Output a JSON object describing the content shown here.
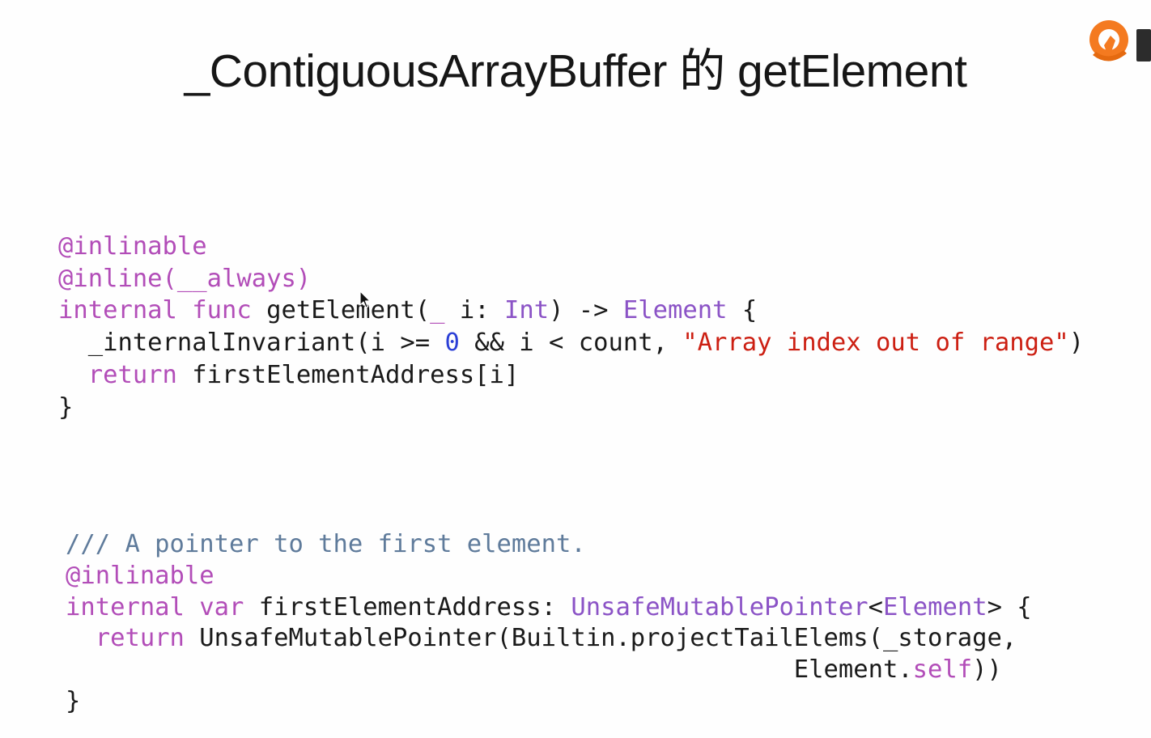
{
  "slide": {
    "title": "_ContiguousArrayBuffer 的 getElement"
  },
  "logo": {
    "icon": "orange-brand-logo-icon",
    "color": "#f47a20"
  },
  "code_block_1": {
    "attr_inlinable": "@inlinable",
    "attr_inline_always": "@inline(__always)",
    "sig_internal": "internal",
    "sig_func": "func",
    "sig_name": "getElement(",
    "sig_underscore": "_",
    "sig_param": "i:",
    "sig_type_int": "Int",
    "sig_arrow": ") ->",
    "sig_type_element": "Element",
    "sig_brace": "{",
    "body1_call": "_internalInvariant(i >=",
    "body1_zero": "0",
    "body1_cond": "&& i < count,",
    "body1_string": "\"Array index out of range\"",
    "body1_close": ")",
    "body2_return": "return",
    "body2_expr": "firstElementAddress[i]",
    "close_brace": "}"
  },
  "code_block_2": {
    "doc_comment": "/// A pointer to the first element.",
    "attr_inlinable": "@inlinable",
    "decl_internal": "internal",
    "decl_var": "var",
    "decl_name": "firstElementAddress:",
    "decl_type_pointer": "UnsafeMutablePointer",
    "decl_lt": "<",
    "decl_type_element": "Element",
    "decl_gt_brace": "> {",
    "body_return": "return",
    "body_call": "UnsafeMutablePointer(Builtin.projectTailElems(_storage,",
    "body_cont_element": "Element.",
    "body_cont_self": "self",
    "body_cont_close": "))",
    "close_brace": "}"
  },
  "colors": {
    "keyword": "#b24db8",
    "type": "#8b53c6",
    "number": "#2b3fd6",
    "string": "#cc1f12",
    "comment": "#5f7b9b",
    "plain": "#1a1a1a"
  },
  "pointer": {
    "icon": "mouse-pointer-icon"
  }
}
